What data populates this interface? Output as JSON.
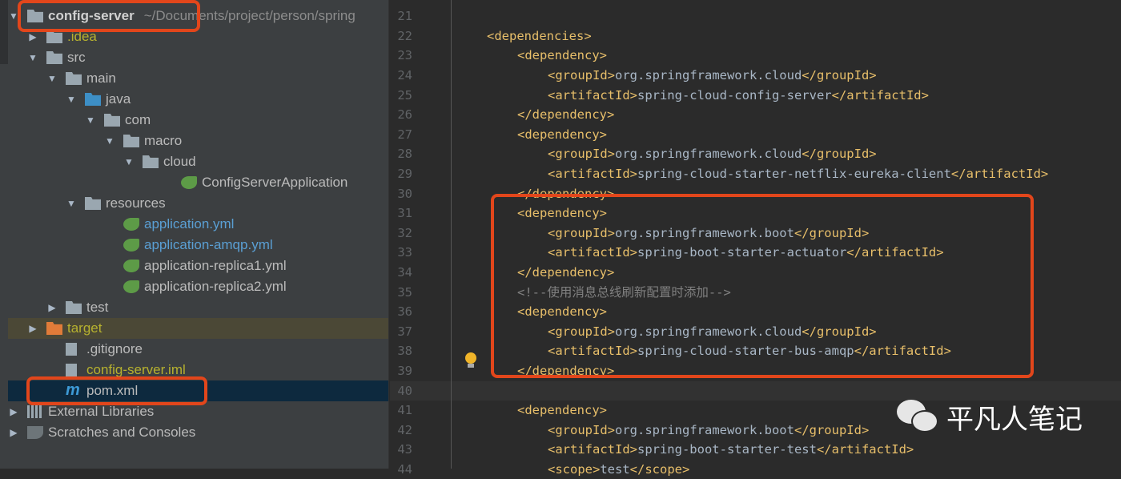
{
  "project": {
    "name": "config-server",
    "path": "~/Documents/project/person/spring"
  },
  "tree": [
    {
      "label": ".idea",
      "level": 1,
      "arrow": "right",
      "icon": "folder-icon",
      "style": "yellow"
    },
    {
      "label": "src",
      "level": 1,
      "arrow": "down",
      "icon": "folder-icon"
    },
    {
      "label": "main",
      "level": 2,
      "arrow": "down",
      "icon": "folder-icon"
    },
    {
      "label": "java",
      "level": 3,
      "arrow": "down",
      "icon": "source-folder-icon"
    },
    {
      "label": "com",
      "level": 4,
      "arrow": "down",
      "icon": "package-icon"
    },
    {
      "label": "macro",
      "level": 5,
      "arrow": "down",
      "icon": "package-icon"
    },
    {
      "label": "cloud",
      "level": 6,
      "arrow": "down",
      "icon": "package-icon"
    },
    {
      "label": "ConfigServerApplication",
      "level": 8,
      "arrow": "",
      "icon": "spring-boot-class-icon"
    },
    {
      "label": "resources",
      "level": 3,
      "arrow": "down",
      "icon": "resources-folder-icon"
    },
    {
      "label": "application.yml",
      "level": 5,
      "arrow": "",
      "icon": "spring-yml-icon",
      "style": "blue"
    },
    {
      "label": "application-amqp.yml",
      "level": 5,
      "arrow": "",
      "icon": "spring-yml-icon",
      "style": "blue"
    },
    {
      "label": "application-replica1.yml",
      "level": 5,
      "arrow": "",
      "icon": "spring-yml-icon"
    },
    {
      "label": "application-replica2.yml",
      "level": 5,
      "arrow": "",
      "icon": "spring-yml-icon"
    },
    {
      "label": "test",
      "level": 2,
      "arrow": "right",
      "icon": "folder-icon"
    },
    {
      "label": "target",
      "level": 1,
      "arrow": "right",
      "icon": "excluded-folder-icon",
      "style": "yellow",
      "row": "excl"
    },
    {
      "label": ".gitignore",
      "level": 2,
      "arrow": "",
      "icon": "ignored-file-icon"
    },
    {
      "label": "config-server.iml",
      "level": 2,
      "arrow": "",
      "icon": "module-file-icon",
      "style": "yellow"
    },
    {
      "label": "pom.xml",
      "level": 2,
      "arrow": "",
      "icon": "maven-icon",
      "row": "sel"
    },
    {
      "label": "External Libraries",
      "level": 0,
      "arrow": "right",
      "icon": "libraries-icon"
    },
    {
      "label": "Scratches and Consoles",
      "level": 0,
      "arrow": "right",
      "icon": "scratches-icon"
    }
  ],
  "code": [
    {
      "n": "21",
      "i": 0
    },
    {
      "n": "22",
      "i": 1,
      "open": "<dependencies>"
    },
    {
      "n": "23",
      "i": 2,
      "open": "<dependency>"
    },
    {
      "n": "24",
      "i": 3,
      "open": "<groupId>",
      "val": "org.springframework.cloud",
      "close": "</groupId>"
    },
    {
      "n": "25",
      "i": 3,
      "open": "<artifactId>",
      "val": "spring-cloud-config-server",
      "close": "</artifactId>"
    },
    {
      "n": "26",
      "i": 2,
      "open": "</dependency>"
    },
    {
      "n": "27",
      "i": 2,
      "open": "<dependency>"
    },
    {
      "n": "28",
      "i": 3,
      "open": "<groupId>",
      "val": "org.springframework.cloud",
      "close": "</groupId>"
    },
    {
      "n": "29",
      "i": 3,
      "open": "<artifactId>",
      "val": "spring-cloud-starter-netflix-eureka-client",
      "close": "</artifactId>"
    },
    {
      "n": "30",
      "i": 2,
      "open": "</dependency>"
    },
    {
      "n": "31",
      "i": 2,
      "open": "<dependency>"
    },
    {
      "n": "32",
      "i": 3,
      "open": "<groupId>",
      "val": "org.springframework.boot",
      "close": "</groupId>"
    },
    {
      "n": "33",
      "i": 3,
      "open": "<artifactId>",
      "val": "spring-boot-starter-actuator",
      "close": "</artifactId>"
    },
    {
      "n": "34",
      "i": 2,
      "open": "</dependency>"
    },
    {
      "n": "35",
      "i": 2,
      "comment": "<!--使用消息总线刷新配置时添加-->"
    },
    {
      "n": "36",
      "i": 2,
      "open": "<dependency>"
    },
    {
      "n": "37",
      "i": 3,
      "open": "<groupId>",
      "val": "org.springframework.cloud",
      "close": "</groupId>"
    },
    {
      "n": "38",
      "i": 3,
      "open": "<artifactId>",
      "val": "spring-cloud-starter-bus-amqp",
      "close": "</artifactId>"
    },
    {
      "n": "39",
      "i": 2,
      "open": "</dependency>"
    },
    {
      "n": "40",
      "i": 0,
      "current": true
    },
    {
      "n": "41",
      "i": 2,
      "open": "<dependency>"
    },
    {
      "n": "42",
      "i": 3,
      "open": "<groupId>",
      "val": "org.springframework.boot",
      "close": "</groupId>"
    },
    {
      "n": "43",
      "i": 3,
      "open": "<artifactId>",
      "val": "spring-boot-starter-test",
      "close": "</artifactId>"
    },
    {
      "n": "44",
      "i": 3,
      "open": "<scope>",
      "val": "test",
      "close": "</scope>"
    }
  ],
  "watermark": {
    "text": "平凡人笔记",
    "icon": "wechat-icon"
  },
  "colors": {
    "highlight": "#e2461b",
    "tag": "#e8bf6a",
    "comment": "#808080"
  }
}
